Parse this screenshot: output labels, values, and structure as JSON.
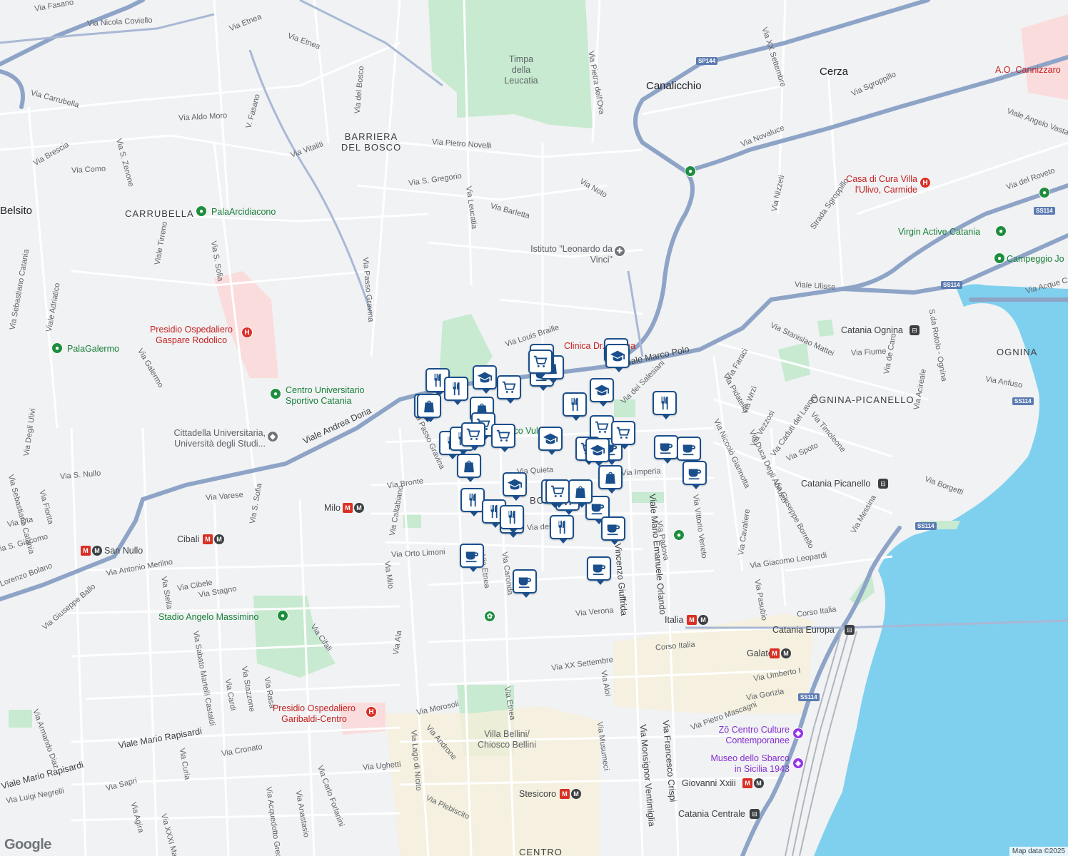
{
  "map": {
    "attribution": "Map data ©2025",
    "brand": "Google",
    "colors": {
      "land": "#f1f2f4",
      "road": "#ffffff",
      "highway": "#8ea4c7",
      "park": "#bfe6c8",
      "hospital": "#f9d6d5",
      "water": "#7fd0ee",
      "pin_border": "#1a4f8b"
    }
  },
  "labels": {
    "roads": [
      "Via Fasano",
      "Via Nicola Coviello",
      "Via Etnea",
      "Via Etnea",
      "Via Carrubella",
      "V. Fasano",
      "Via del Bosco",
      "Via Aldo Moro",
      "Via Vitaliti",
      "Via Brescia",
      "Via S. Zenone",
      "Via Como",
      "Via Pietro Novelli",
      "Via S. Gregorio",
      "Via Leucatia",
      "Via Barletta",
      "Via Noto",
      "Via Pietra dell'Ova",
      "Via XX Settembre",
      "Via Sgroppillo",
      "Via Novaluce",
      "Via Nizzeti",
      "Strada Sgroppillo",
      "Viale Angelo Vasta",
      "Via del Roveto",
      "Viale Ulisse",
      "Via Acque Ca",
      "Viale Tirreno",
      "Via S. Sofia",
      "Via Passo Gravina",
      "Via Sebastiano Catania",
      "Viale Adriatico",
      "Via Galermo",
      "Via Louis Braille",
      "Viale Marco Polo",
      "Via dei Salesiani",
      "Via Faraci",
      "Via Stanislao Mattei",
      "Via Fiume",
      "Via de Caro",
      "S.da Rotolo - Ognina",
      "Via Anfuso",
      "Via Acireale",
      "Via Wrzi",
      "Via Pidatella",
      "Via Vezzosi",
      "Via Caduti del Lavoro",
      "Via Timoleone",
      "Via Spoto",
      "Via Duca Degli Abruzzi",
      "Via Niccolò Giannotta",
      "Via Giuseppe Borrello",
      "Via Borgetti",
      "Via Messina",
      "Viale Andrea Doria",
      "Via Passo Gravina",
      "Via Degli Ulivi",
      "Via S. Nullo",
      "Via Fiorita",
      "Via Sebastiano Catania",
      "Via Varese",
      "Via S. Sofia",
      "Via Bronte",
      "Via Cifali",
      "Via Caltabiano",
      "Via Quieta",
      "Via Imperia",
      "Via Vittorio Veneto",
      "Via Padova",
      "Via Cavaliere",
      "Via Pasubio",
      "Via Giacomo Leopardi",
      "Via Orto Limoni",
      "Via Etnea",
      "Via Caronda",
      "Via Milo",
      "Via Antonio Merlino",
      "Via Cibele",
      "Via Stagno",
      "Via Stella",
      "Via Giuseppe Ballo",
      "Via Ota",
      "Via S. Giacomo",
      "Lorenzo Bolano",
      "Via Verona",
      "Corso Italia",
      "Corso Italia",
      "Via XX Settembre",
      "Via Aloi",
      "Via Umberto I",
      "Via Gorizia",
      "Via Pietro Mascagni",
      "Via Morosoli",
      "Via Androne",
      "Via Etnea",
      "Via Lago di Nicito",
      "Via Cronato",
      "Viale Mario Rapisardi",
      "Viale Mario Rapisardi",
      "Via Luigi Negrelli",
      "Via Sapri",
      "Via Ughetti",
      "Via Plebiscito",
      "Via Carlo Forlanini",
      "Via Anastasio",
      "Via Acquedotto Greco",
      "Via Curia",
      "Via Agira",
      "Via XXXI Maggio",
      "Via Armando Diaz",
      "Via Sabato Martelli Castaldi",
      "Via Stazzone",
      "Via Cardi",
      "Via Rasà",
      "Via Ala",
      "Via Musumeci",
      "Via Monsignor Ventimiglia",
      "Via Francesco Crispi",
      "Viale Vincenzo Giuffrida",
      "Viale Mario Emanuele Orlando",
      "Via dei Mi"
    ],
    "areas": [
      "BARRIERA DEL BOSCO",
      "CARRUBELLA",
      "OGNINA",
      "OGNINA-PICANELLO",
      "CENTRO",
      "BO"
    ],
    "towns": [
      "Canalicchio",
      "Cerza",
      "Belsito"
    ],
    "places_green": [
      "PalaArcidiacono",
      "PalaGalermo",
      "Centro Universitario Sportivo Catania",
      "Virgin Active Catania",
      "Campeggio Jo",
      "Stadio Angelo Massimino"
    ],
    "places_red": [
      "A.O. Cannizzaro",
      "Casa di Cura Villa l'Ulivo, Carmide",
      "Presidio Ospedaliero Gaspare Rodolico",
      "Presidio Ospedaliero Garibaldi-Centro",
      "Clinica Dr. Andrea"
    ],
    "places_grey": [
      "Timpa della Leucatia",
      "Istituto \"Leonardo da Vinci\"",
      "Cittadella Universitaria, Università degli Studi...",
      "Villa Bellini/ Chiosco Bellini",
      "Parco Vulcano"
    ],
    "places_purple": [
      "Zō Centro Culture Contemporanee",
      "Museo dello Sbarco in Sicilia 1943"
    ],
    "metro": [
      "Milo",
      "Cibali",
      "San Nullo",
      "Italia",
      "Galatea",
      "Giovanni Xxiii",
      "Stesicoro",
      "Borgo"
    ],
    "rail": [
      "Catania Ognina",
      "Catania Picanello",
      "Catania Europa",
      "Catania Centrale"
    ],
    "shields": [
      "SP144",
      "SS114",
      "SS114",
      "SS114",
      "SS114",
      "SS114"
    ]
  },
  "pins": {
    "restaurant": 14,
    "cafe": 10,
    "shopping": 6,
    "grocery": 10,
    "school": 7
  }
}
